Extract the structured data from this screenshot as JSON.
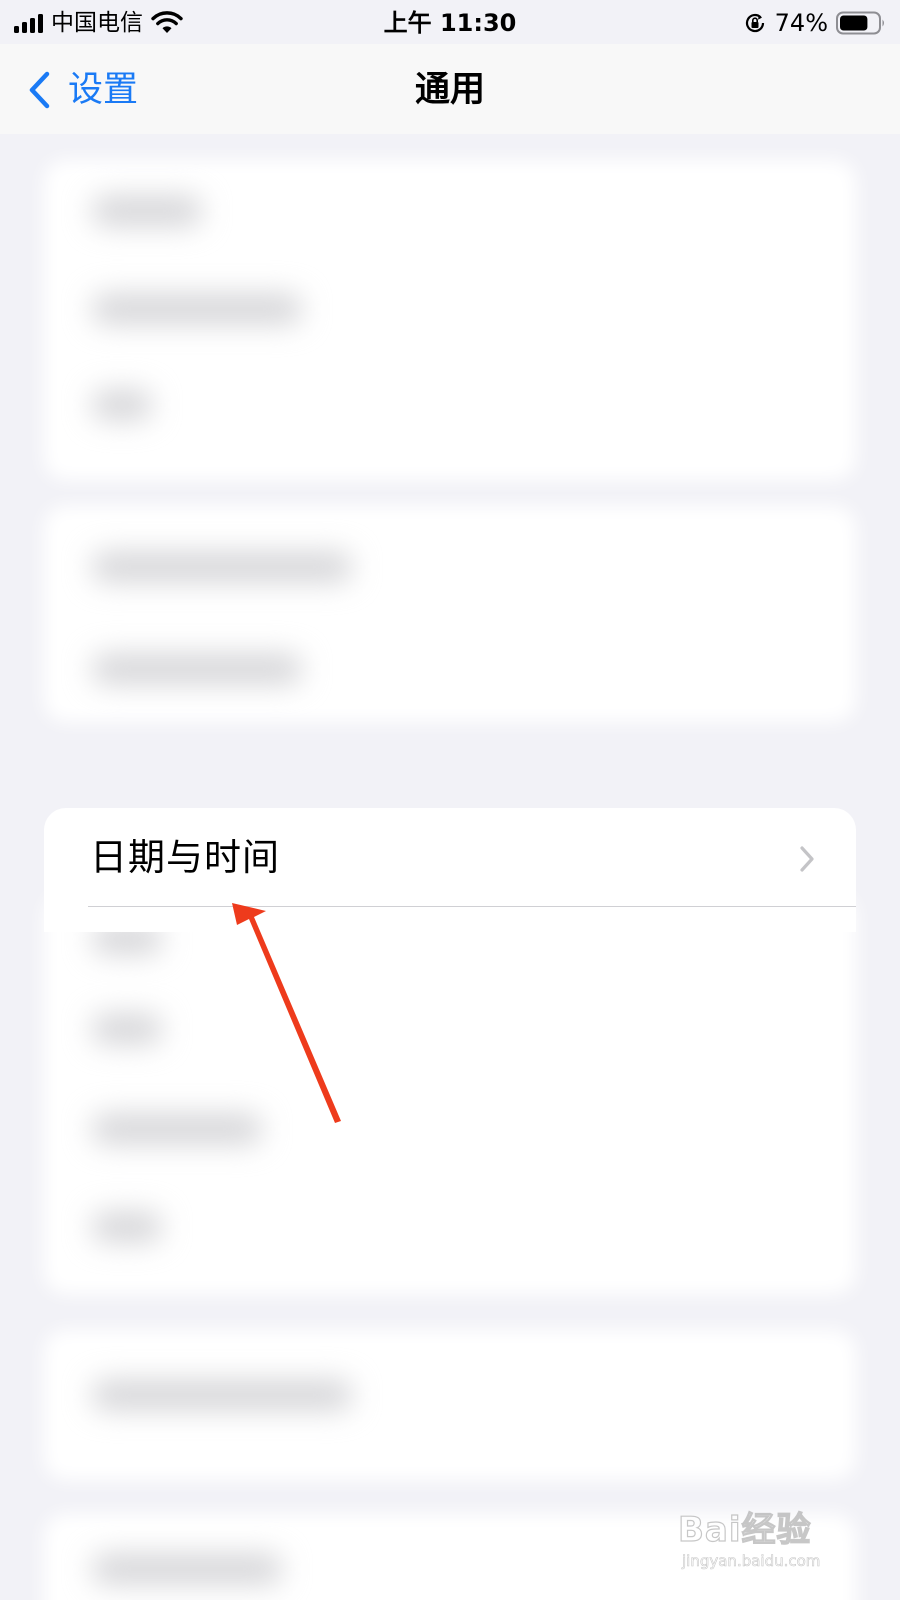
{
  "status_bar": {
    "carrier": "中国电信",
    "time": "上午 11:30",
    "battery_percent": "74%",
    "battery_level": 0.74,
    "signal_bars": 4,
    "icons": [
      "signal-icon",
      "wifi-icon",
      "orientation-lock-icon",
      "battery-icon"
    ]
  },
  "nav": {
    "back_label": "设置",
    "title": "通用"
  },
  "settings": {
    "focused_row": {
      "label": "日期与时间",
      "icon": "chevron-right-icon"
    }
  },
  "annotation": {
    "arrow_color": "#ee3b1c"
  },
  "watermark": {
    "brand": "Bai经验",
    "url": "jingyan.baidu.com"
  },
  "colors": {
    "accent": "#1a7af5",
    "background": "#f2f2f7"
  }
}
